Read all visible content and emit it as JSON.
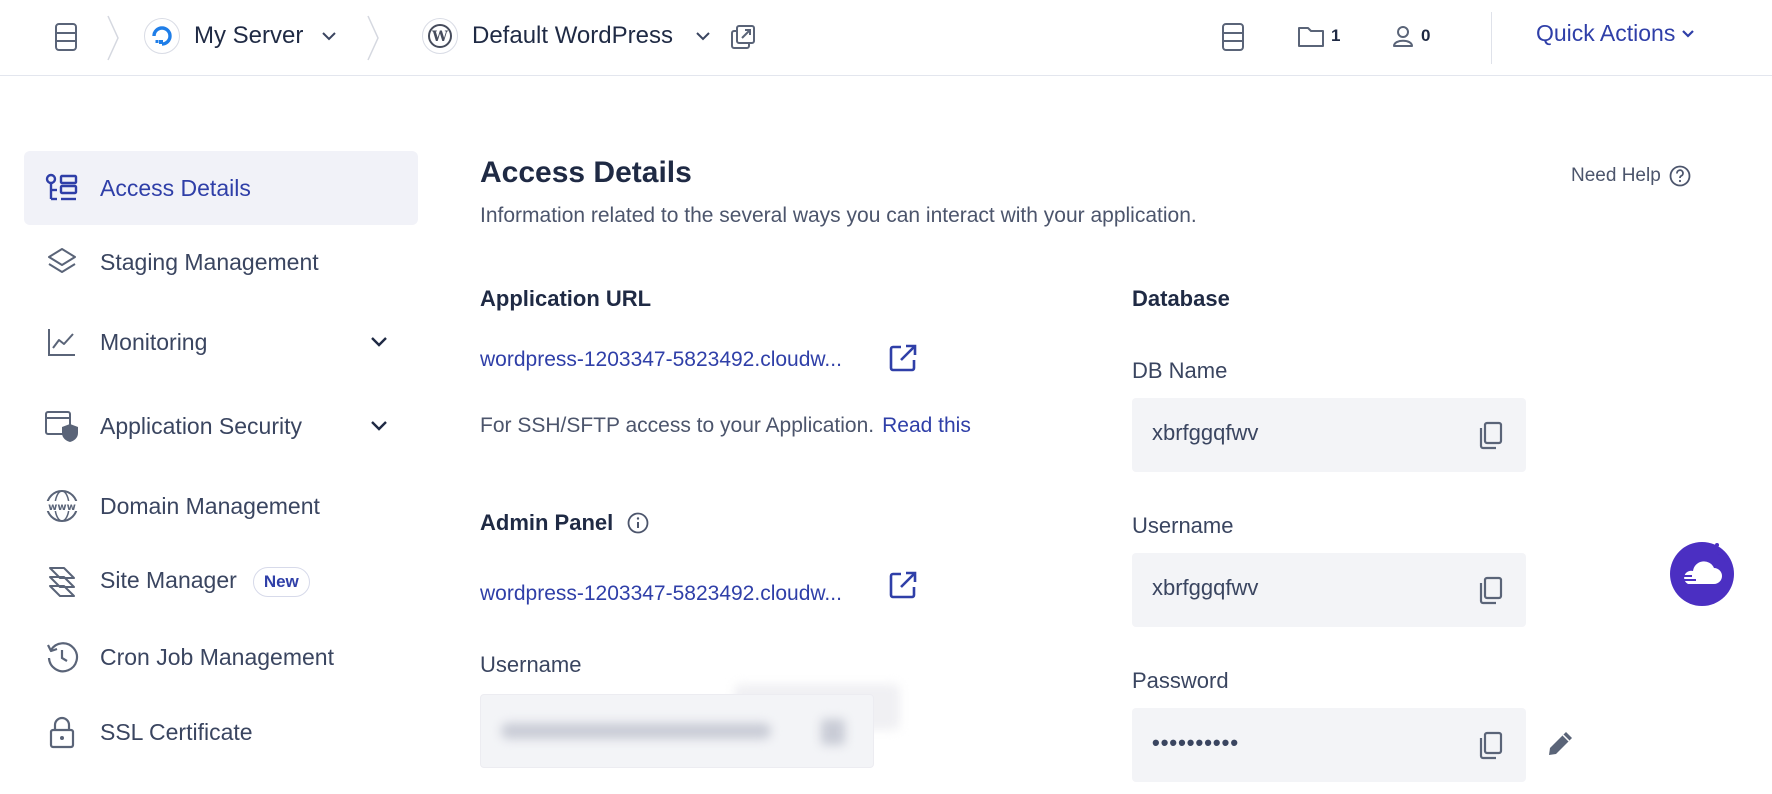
{
  "topbar": {
    "server_name": "My Server",
    "app_name": "Default WordPress",
    "folder_count": "1",
    "user_count": "0",
    "quick_actions_label": "Quick Actions"
  },
  "sidebar": {
    "items": [
      {
        "label": "Access Details",
        "icon": "access-details-icon",
        "active": true
      },
      {
        "label": "Staging Management",
        "icon": "layers-icon"
      },
      {
        "label": "Monitoring",
        "icon": "chart-icon",
        "expandable": true
      },
      {
        "label": "Application Security",
        "icon": "shield-icon",
        "expandable": true
      },
      {
        "label": "Domain Management",
        "icon": "www-icon"
      },
      {
        "label": "Site Manager",
        "icon": "site-manager-icon",
        "badge": "New"
      },
      {
        "label": "Cron Job Management",
        "icon": "history-icon"
      },
      {
        "label": "SSL Certificate",
        "icon": "lock-icon"
      }
    ]
  },
  "main": {
    "title": "Access Details",
    "description": "Information related to the several ways you can interact with your application.",
    "need_help": "Need Help",
    "app_url": {
      "heading": "Application URL",
      "url": "wordpress-1203347-5823492.cloudw...",
      "ssh_text": "For SSH/SFTP access to your Application.",
      "read_this": "Read this"
    },
    "admin_panel": {
      "heading": "Admin Panel",
      "url": "wordpress-1203347-5823492.cloudw...",
      "username_label": "Username"
    },
    "database": {
      "heading": "Database",
      "db_name_label": "DB Name",
      "db_name": "xbrfggqfwv",
      "username_label": "Username",
      "username": "xbrfggqfwv",
      "password_label": "Password",
      "password": "••••••••••"
    }
  },
  "colors": {
    "accent": "#2f3fa8",
    "text": "#1f2a44",
    "muted": "#4c556c",
    "field_bg": "#f3f4f7",
    "active_bg": "#f1f2f8",
    "chat": "#4b2fc2"
  }
}
